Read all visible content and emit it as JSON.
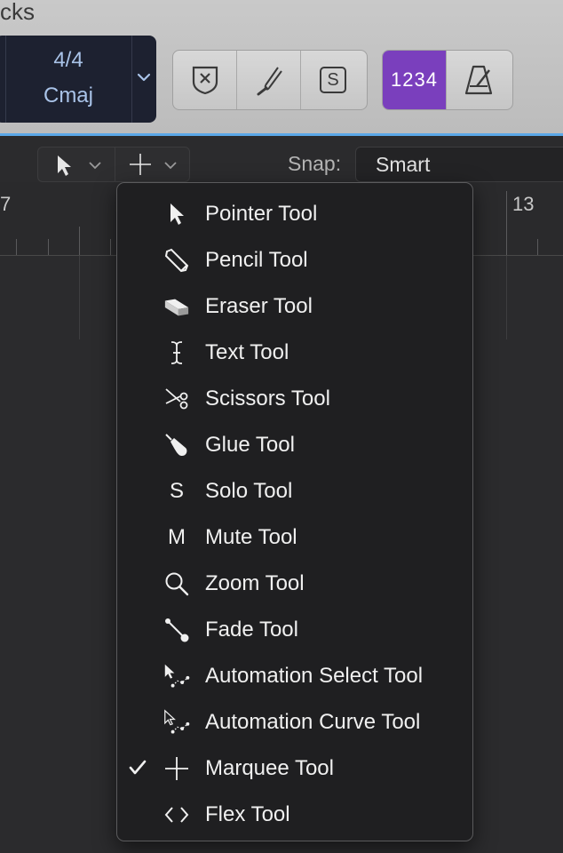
{
  "header": {
    "partial_title": "cks",
    "time_signature": "4/4",
    "key": "Cmaj",
    "count_in": "1234",
    "solo_letter": "S"
  },
  "toolbar": {
    "snap_label": "Snap:",
    "snap_value": "Smart"
  },
  "ruler": {
    "left_bar": "7",
    "right_bar": "13"
  },
  "tool_menu": {
    "items": [
      {
        "label": "Pointer Tool",
        "icon": "pointer-icon",
        "checked": false
      },
      {
        "label": "Pencil Tool",
        "icon": "pencil-icon",
        "checked": false
      },
      {
        "label": "Eraser Tool",
        "icon": "eraser-icon",
        "checked": false
      },
      {
        "label": "Text Tool",
        "icon": "text-cursor-icon",
        "checked": false
      },
      {
        "label": "Scissors Tool",
        "icon": "scissors-icon",
        "checked": false
      },
      {
        "label": "Glue Tool",
        "icon": "glue-icon",
        "checked": false
      },
      {
        "label": "Solo Tool",
        "icon": "solo-icon",
        "glyph": "S",
        "checked": false
      },
      {
        "label": "Mute Tool",
        "icon": "mute-icon",
        "glyph": "M",
        "checked": false
      },
      {
        "label": "Zoom Tool",
        "icon": "magnifier-icon",
        "checked": false
      },
      {
        "label": "Fade Tool",
        "icon": "fade-icon",
        "checked": false
      },
      {
        "label": "Automation Select Tool",
        "icon": "automation-select-icon",
        "checked": false
      },
      {
        "label": "Automation Curve Tool",
        "icon": "automation-curve-icon",
        "checked": false
      },
      {
        "label": "Marquee Tool",
        "icon": "crosshair-icon",
        "checked": true
      },
      {
        "label": "Flex Tool",
        "icon": "flex-icon",
        "checked": false
      }
    ]
  },
  "colors": {
    "accent_blue": "#5aa7e8",
    "count_in_purple": "#7a3fbd",
    "menu_bg": "#1f1f21"
  }
}
